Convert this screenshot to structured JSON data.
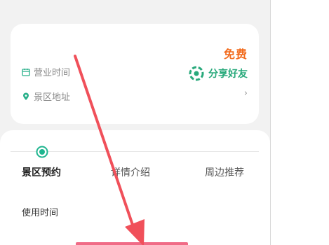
{
  "info_card": {
    "price": "免费",
    "hours_label": "营业时间",
    "address_label": "景区地址",
    "share_label": "分享好友",
    "chevron": "›"
  },
  "tabs": [
    {
      "label": "景区预约",
      "active": true
    },
    {
      "label": "详情介绍",
      "active": false
    },
    {
      "label": "周边推荐",
      "active": false
    }
  ],
  "booking": {
    "use_time_label": "使用时间"
  },
  "icons": {
    "hours": "calendar-icon",
    "address": "location-pin-icon",
    "share": "share-icon",
    "tab_indicator": "ring-dot-icon"
  },
  "colors": {
    "price": "#f26b1d",
    "share": "#28a97b",
    "accent_green": "#1fb58f",
    "arrow": "#f0505a",
    "bottom_bar": "#f06b86"
  }
}
